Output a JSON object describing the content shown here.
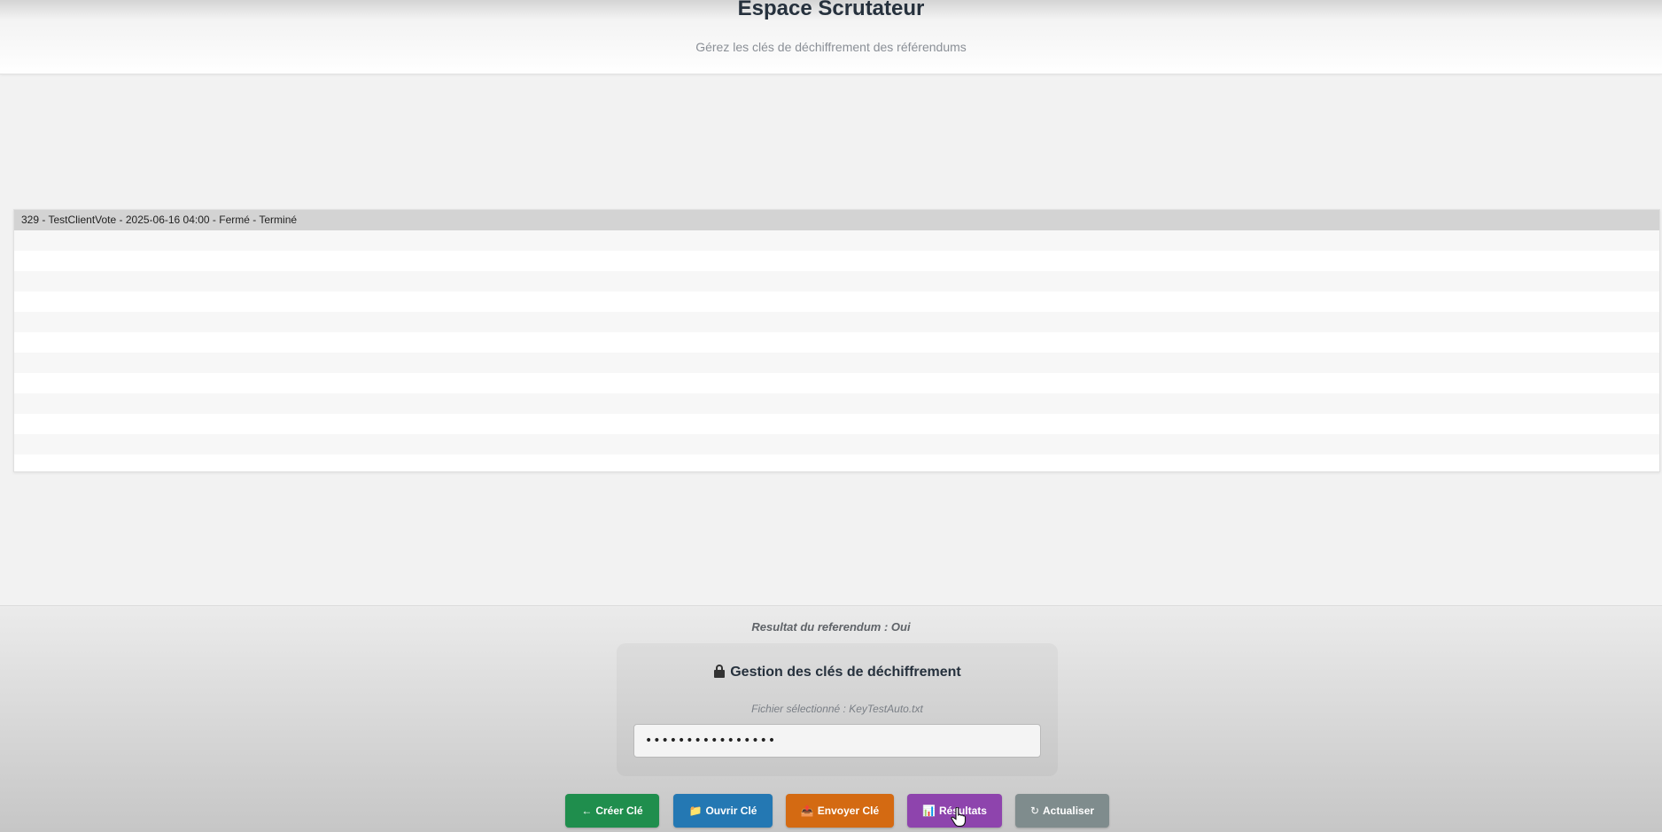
{
  "header": {
    "title": "Espace Scrutateur",
    "subtitle": "Gérez les clés de déchiffrement des référendums"
  },
  "referendum_list": {
    "selected_index": 0,
    "items": [
      "329 - TestClientVote - 2025-06-16 04:00 - Fermé - Terminé"
    ]
  },
  "result": {
    "text": "Resultat du referendum : Oui"
  },
  "key_panel": {
    "title": "Gestion des clés de déchiffrement",
    "title_icon": "lock-key-icon",
    "file_info": "Fichier sélectionné : KeyTestAuto.txt",
    "key_value": "••••••••••••••••"
  },
  "buttons": {
    "create": {
      "icon": "←",
      "label": "Créer Clé",
      "color": "#1f8e4d"
    },
    "open": {
      "icon": "📁",
      "label": "Ouvrir Clé",
      "color": "#2478b3"
    },
    "send": {
      "icon": "📤",
      "label": "Envoyer Clé",
      "color": "#d46a12"
    },
    "results": {
      "icon": "📊",
      "label": "Résultats",
      "color": "#8e44ad"
    },
    "refresh": {
      "icon": "↻",
      "label": "Actualiser",
      "color": "#7f8c8d"
    }
  }
}
